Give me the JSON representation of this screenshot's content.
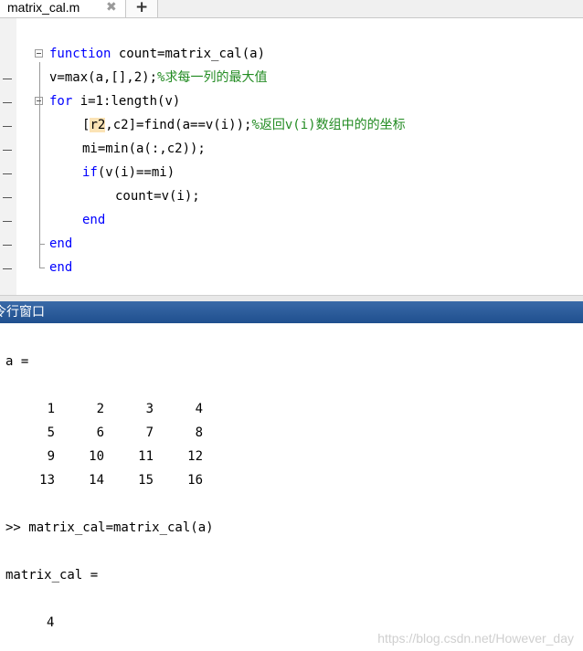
{
  "tab": {
    "title": "matrix_cal.m",
    "close": "✖",
    "add": "+"
  },
  "editor": {
    "lines": [
      {
        "indent": "",
        "kw": "function",
        "code": " count=matrix_cal(a)",
        "comment": ""
      },
      {
        "indent": "",
        "kw": "",
        "code": "v=max(a,[],2);",
        "comment": "%求每一列的最大值"
      },
      {
        "indent": "",
        "kw": "for",
        "code": " i=1:length(v)",
        "comment": ""
      },
      {
        "indent": "",
        "pre": "[",
        "hl": "r2",
        "code": ",c2]=find(a==v(i));",
        "comment": "%返回v(i)数组中的的坐标"
      },
      {
        "indent": "",
        "kw": "",
        "code": "mi=min(a(:,c2));",
        "comment": ""
      },
      {
        "indent": "",
        "kw": "if",
        "code": "(v(i)==mi)",
        "comment": ""
      },
      {
        "indent": "",
        "kw": "",
        "code": "count=v(i);",
        "comment": ""
      },
      {
        "indent": "",
        "kw": "end",
        "code": "",
        "comment": ""
      },
      {
        "indent": "",
        "kw": "end",
        "code": "",
        "comment": ""
      },
      {
        "indent": "",
        "kw": "end",
        "code": "",
        "comment": ""
      }
    ]
  },
  "command_window": {
    "title": "令行窗口",
    "var_a": "a =",
    "matrix": [
      [
        "1",
        "2",
        "3",
        "4"
      ],
      [
        "5",
        "6",
        "7",
        "8"
      ],
      [
        "9",
        "10",
        "11",
        "12"
      ],
      [
        "13",
        "14",
        "15",
        "16"
      ]
    ],
    "prompt": ">> matrix_cal=matrix_cal(a)",
    "result_label": "matrix_cal =",
    "result_value": "4"
  },
  "watermark": "https://blog.csdn.net/However_day"
}
